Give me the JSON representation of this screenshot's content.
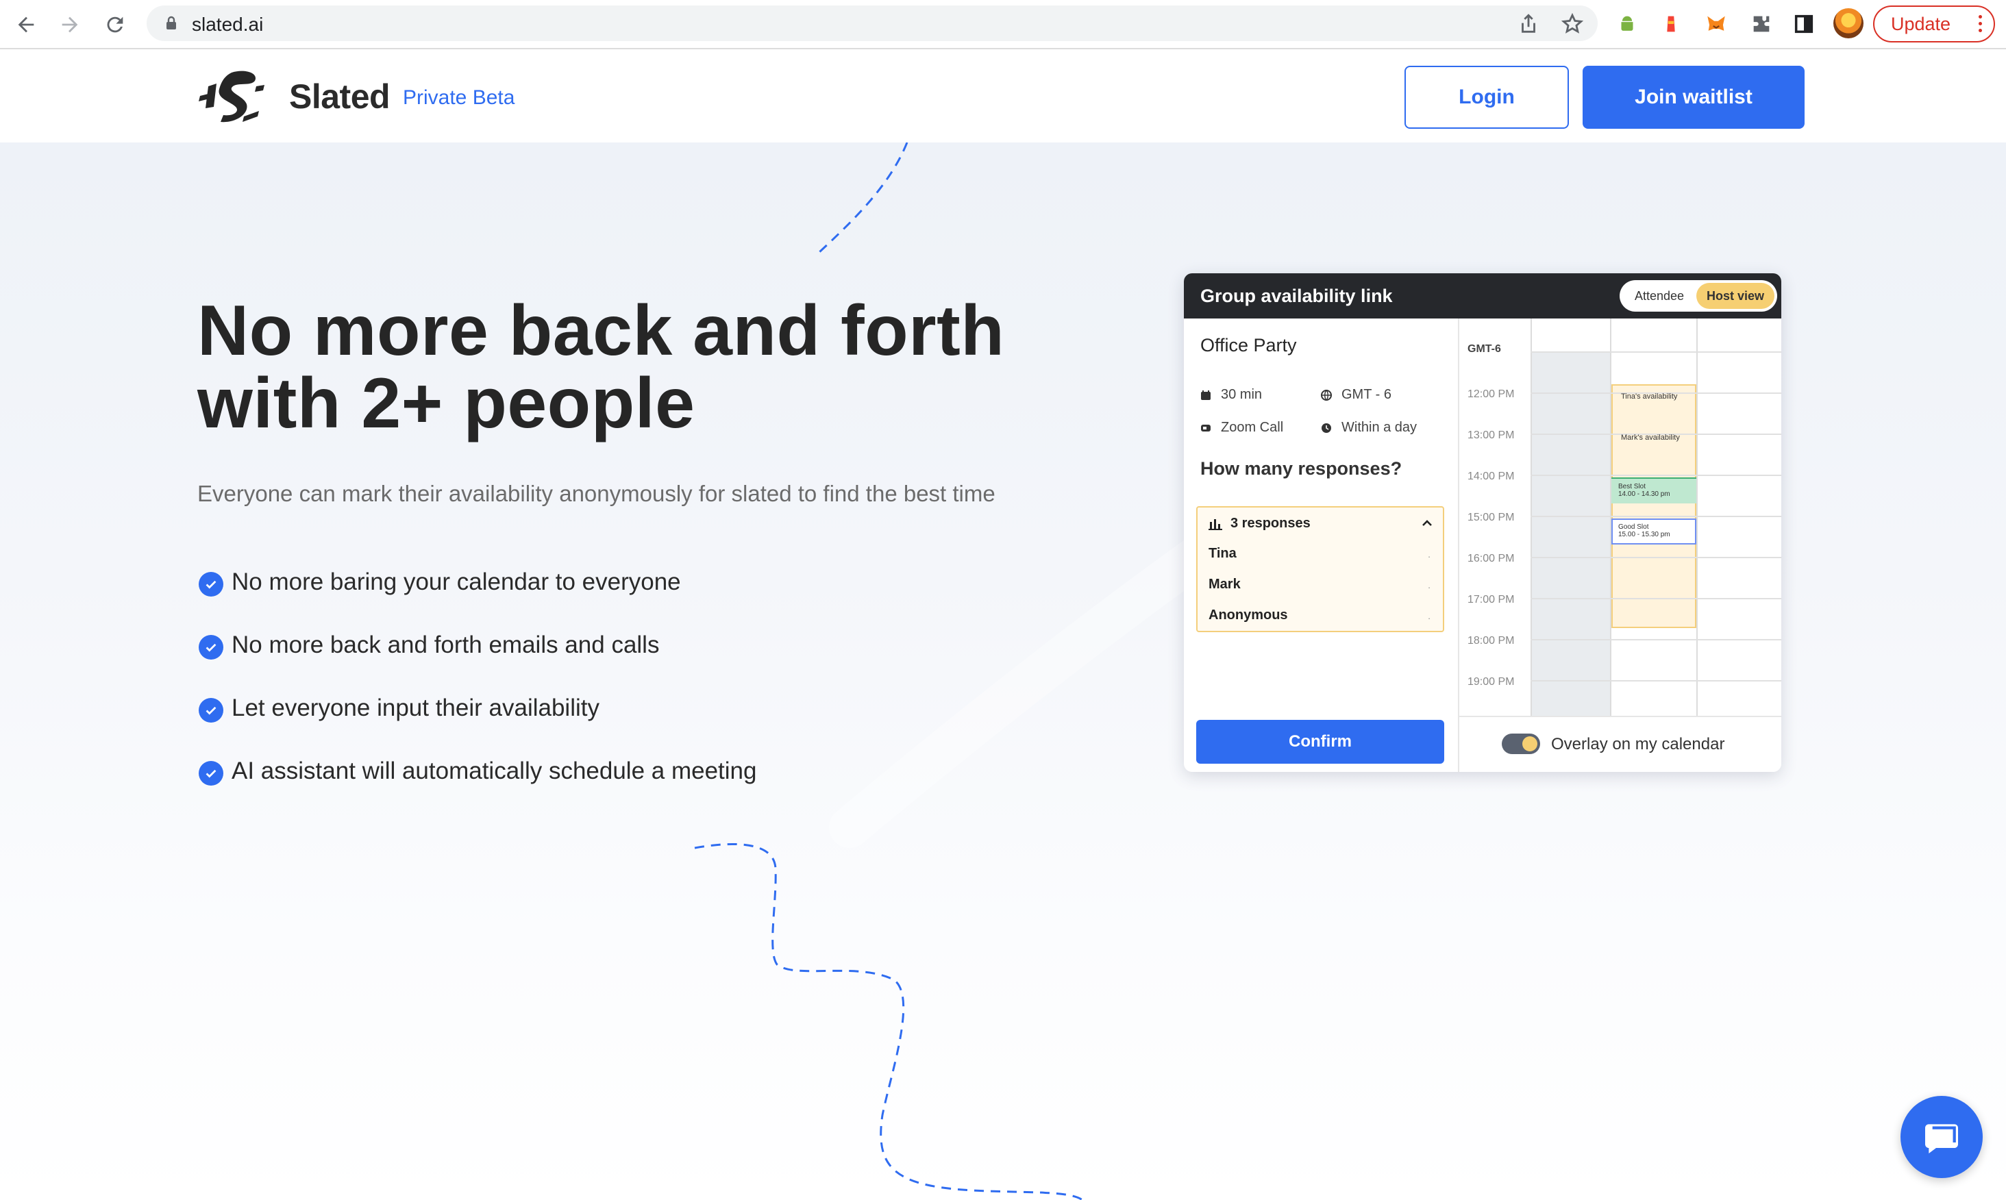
{
  "browser": {
    "url": "slated.ai",
    "update_label": "Update"
  },
  "header": {
    "brand": "Slated",
    "badge": "Private Beta",
    "login_label": "Login",
    "join_label": "Join waitlist"
  },
  "hero": {
    "headline_line1": "No more back and forth",
    "headline_line2": "with 2+ people",
    "subtext": "Everyone can mark their availability anonymously for slated to find the best time",
    "features": [
      "No more baring your calendar to everyone",
      "No more back and forth emails and calls",
      "Let everyone input their availability",
      "AI assistant will automatically schedule a meeting"
    ]
  },
  "widget": {
    "title": "Group availability link",
    "toggle": {
      "attendee": "Attendee",
      "host": "Host view",
      "selected": "Host view"
    },
    "event_name": "Office Party",
    "duration": "30 min",
    "timezone": "GMT - 6",
    "location": "Zoom Call",
    "deadline": "Within a day",
    "question": "How many responses?",
    "responses": {
      "summary": "3 responses",
      "people": [
        "Tina",
        "Mark",
        "Anonymous"
      ],
      "marker": "."
    },
    "confirm_label": "Confirm",
    "calendar": {
      "tz_label": "GMT-6",
      "times": [
        "12:00 PM",
        "13:00 PM",
        "14:00 PM",
        "15:00 PM",
        "16:00 PM",
        "17:00 PM",
        "18:00 PM",
        "19:00 PM"
      ],
      "tina_label": "Tina's availability",
      "mark_label": "Mark's availability",
      "best_slot_title": "Best Slot",
      "best_slot_time": "14.00 - 14.30 pm",
      "good_slot_title": "Good Slot",
      "good_slot_time": "15.00 - 15.30 pm"
    },
    "overlay_label": "Overlay on my calendar",
    "overlay_on": true
  },
  "colors": {
    "accent": "#2f6cf0",
    "dark_bar": "#26282c",
    "highlight": "#f6cf72",
    "update_red": "#d93025"
  },
  "icons": {
    "check": "check-circle-icon",
    "chat": "chat-bubble-icon"
  }
}
